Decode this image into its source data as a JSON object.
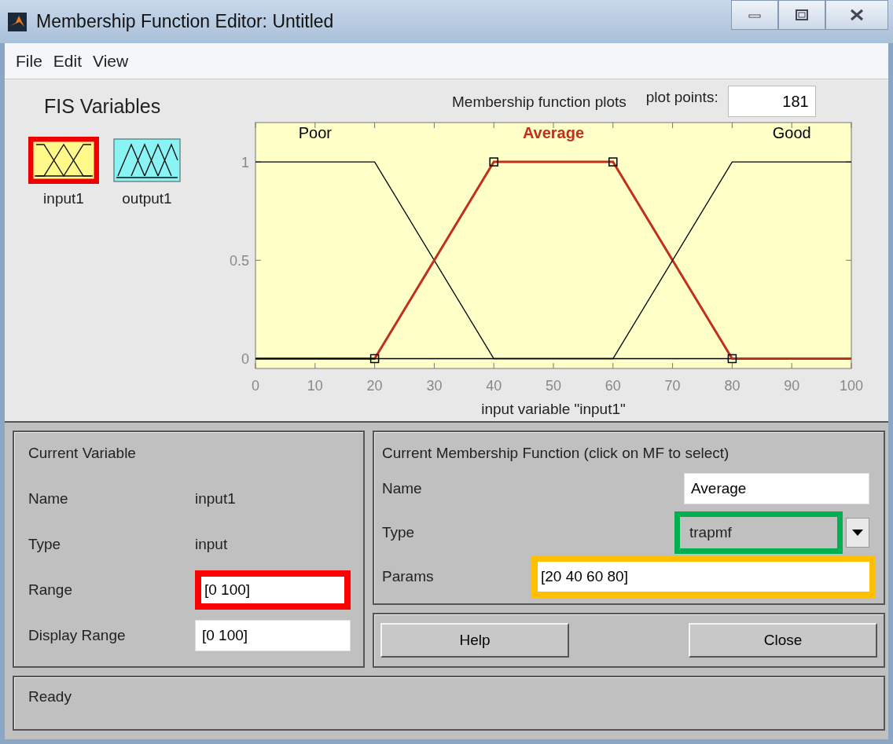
{
  "window": {
    "title": "Membership Function Editor: Untitled"
  },
  "menu": [
    "File",
    "Edit",
    "View"
  ],
  "fis_variables": {
    "title": "FIS Variables",
    "items": [
      {
        "label": "input1",
        "kind": "input",
        "selected": true
      },
      {
        "label": "output1",
        "kind": "output",
        "selected": false
      }
    ]
  },
  "plot": {
    "plot_points_label": "plot points:",
    "plot_points": "181",
    "chart_data": {
      "type": "line",
      "title": "Membership function plots",
      "xlabel": "input variable \"input1\"",
      "x": [
        0,
        20,
        40,
        60,
        80,
        100
      ],
      "xlim": [
        0,
        100
      ],
      "ylim": [
        -0.05,
        1.2
      ],
      "xticks": [
        0,
        10,
        20,
        30,
        40,
        50,
        60,
        70,
        80,
        90,
        100
      ],
      "yticks": [
        0,
        0.5,
        1
      ],
      "series": [
        {
          "name": "Poor",
          "color": "#000000",
          "values": [
            1,
            1,
            0,
            0,
            0,
            0
          ]
        },
        {
          "name": "Average",
          "color": "#c0301c",
          "values": [
            0,
            0,
            1,
            1,
            0,
            0
          ]
        },
        {
          "name": "Good",
          "color": "#000000",
          "values": [
            0,
            0,
            0,
            0,
            1,
            1
          ]
        }
      ]
    },
    "curves": [
      {
        "selected": false
      },
      {
        "selected": true
      },
      {
        "selected": false
      }
    ]
  },
  "current_variable": {
    "title": "Current Variable",
    "rows": [
      {
        "label": "Name",
        "kind": "text",
        "value": "input1"
      },
      {
        "label": "Type",
        "kind": "text",
        "value": "input"
      },
      {
        "label": "Range",
        "kind": "field",
        "value": "[0 100]",
        "color": "#ff0000"
      },
      {
        "label": "Display Range",
        "kind": "field",
        "value": "[0 100]"
      }
    ]
  },
  "current_mf": {
    "title": "Current Membership Function (click on MF to select)",
    "rows": [
      {
        "label": "Name",
        "kind": "field",
        "value": "Average"
      },
      {
        "label": "Type",
        "kind": "dropdown",
        "value": "trapmf",
        "color": "#00b050"
      },
      {
        "label": "Params",
        "kind": "field",
        "value": "[20 40 60 80]",
        "color": "#ffc000"
      }
    ]
  },
  "buttons": [
    "Help",
    "Close"
  ],
  "status_bar": "Ready"
}
